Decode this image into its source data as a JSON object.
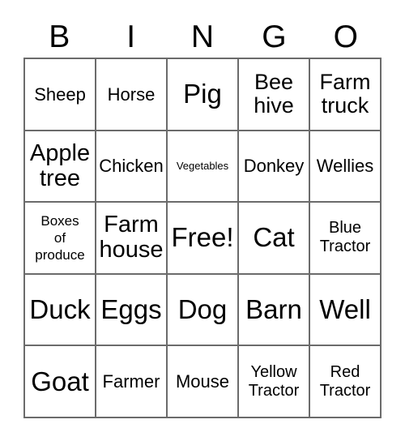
{
  "card": {
    "type": "bingo-card",
    "theme": "Farm",
    "header_letters": [
      "B",
      "I",
      "N",
      "G",
      "O"
    ],
    "columns": 5,
    "rows": 5,
    "free_space": {
      "label": "Free!",
      "row": 3,
      "column": 3
    },
    "border_color": "#6b6b6b",
    "background_color": "#ffffff",
    "text_color": "#000000",
    "cells": [
      [
        {
          "text": "Sheep",
          "size": "sz-md"
        },
        {
          "text": "Horse",
          "size": "sz-md"
        },
        {
          "text": "Pig",
          "size": "sz-xl"
        },
        {
          "text": "Bee\nhive",
          "size": "sz-ml"
        },
        {
          "text": "Farm\ntruck",
          "size": "sz-ml"
        }
      ],
      [
        {
          "text": "Apple\ntree",
          "size": "sz-lg"
        },
        {
          "text": "Chicken",
          "size": "sz-md"
        },
        {
          "text": "Vegetables",
          "size": "sz-xxs"
        },
        {
          "text": "Donkey",
          "size": "sz-md"
        },
        {
          "text": "Wellies",
          "size": "sz-md"
        }
      ],
      [
        {
          "text": "Boxes\nof\nproduce",
          "size": "sz-xs"
        },
        {
          "text": "Farm\nhouse",
          "size": "sz-lg"
        },
        {
          "text": "Free!",
          "size": "sz-xl"
        },
        {
          "text": "Cat",
          "size": "sz-xl"
        },
        {
          "text": "Blue\nTractor",
          "size": "sz-sm"
        }
      ],
      [
        {
          "text": "Duck",
          "size": "sz-xl"
        },
        {
          "text": "Eggs",
          "size": "sz-xl"
        },
        {
          "text": "Dog",
          "size": "sz-xl"
        },
        {
          "text": "Barn",
          "size": "sz-xl"
        },
        {
          "text": "Well",
          "size": "sz-xl"
        }
      ],
      [
        {
          "text": "Goat",
          "size": "sz-xl"
        },
        {
          "text": "Farmer",
          "size": "sz-md"
        },
        {
          "text": "Mouse",
          "size": "sz-md"
        },
        {
          "text": "Yellow\nTractor",
          "size": "sz-sm"
        },
        {
          "text": "Red\nTractor",
          "size": "sz-sm"
        }
      ]
    ]
  }
}
